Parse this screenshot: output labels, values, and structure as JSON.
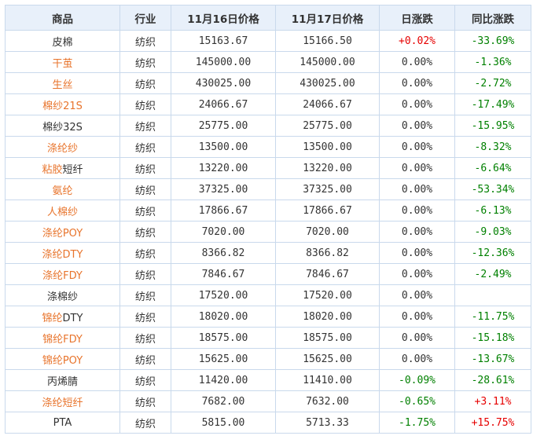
{
  "table": {
    "headers": [
      "商品",
      "行业",
      "11月16日价格",
      "11月17日价格",
      "日涨跌",
      "同比涨跌"
    ],
    "rows": [
      {
        "name": "皮棉",
        "name_link": "",
        "industry": "纺织",
        "price_1": "15163.67",
        "price_2": "15166.50",
        "daily": "+0.02%",
        "daily_dir": "up",
        "yoy": "-33.69%",
        "yoy_dir": "down"
      },
      {
        "name": "",
        "name_link": "干茧",
        "industry": "纺织",
        "price_1": "145000.00",
        "price_2": "145000.00",
        "daily": "0.00%",
        "daily_dir": "flat",
        "yoy": "-1.36%",
        "yoy_dir": "down"
      },
      {
        "name": "",
        "name_link": "生丝",
        "industry": "纺织",
        "price_1": "430025.00",
        "price_2": "430025.00",
        "daily": "0.00%",
        "daily_dir": "flat",
        "yoy": "-2.72%",
        "yoy_dir": "down"
      },
      {
        "name": "",
        "name_link": "棉纱21S",
        "industry": "纺织",
        "price_1": "24066.67",
        "price_2": "24066.67",
        "daily": "0.00%",
        "daily_dir": "flat",
        "yoy": "-17.49%",
        "yoy_dir": "down"
      },
      {
        "name": "棉纱32S",
        "name_link": "",
        "industry": "纺织",
        "price_1": "25775.00",
        "price_2": "25775.00",
        "daily": "0.00%",
        "daily_dir": "flat",
        "yoy": "-15.95%",
        "yoy_dir": "down"
      },
      {
        "name": "",
        "name_link": "涤纶纱",
        "industry": "纺织",
        "price_1": "13500.00",
        "price_2": "13500.00",
        "daily": "0.00%",
        "daily_dir": "flat",
        "yoy": "-8.32%",
        "yoy_dir": "down"
      },
      {
        "name": "短纤",
        "name_link": "粘胶",
        "industry": "纺织",
        "price_1": "13220.00",
        "price_2": "13220.00",
        "daily": "0.00%",
        "daily_dir": "flat",
        "yoy": "-6.64%",
        "yoy_dir": "down"
      },
      {
        "name": "",
        "name_link": "氨纶",
        "industry": "纺织",
        "price_1": "37325.00",
        "price_2": "37325.00",
        "daily": "0.00%",
        "daily_dir": "flat",
        "yoy": "-53.34%",
        "yoy_dir": "down"
      },
      {
        "name": "",
        "name_link": "人棉纱",
        "industry": "纺织",
        "price_1": "17866.67",
        "price_2": "17866.67",
        "daily": "0.00%",
        "daily_dir": "flat",
        "yoy": "-6.13%",
        "yoy_dir": "down"
      },
      {
        "name": "",
        "name_link": "涤纶POY",
        "industry": "纺织",
        "price_1": "7020.00",
        "price_2": "7020.00",
        "daily": "0.00%",
        "daily_dir": "flat",
        "yoy": "-9.03%",
        "yoy_dir": "down"
      },
      {
        "name": "",
        "name_link": "涤纶DTY",
        "industry": "纺织",
        "price_1": "8366.82",
        "price_2": "8366.82",
        "daily": "0.00%",
        "daily_dir": "flat",
        "yoy": "-12.36%",
        "yoy_dir": "down"
      },
      {
        "name": "",
        "name_link": "涤纶FDY",
        "industry": "纺织",
        "price_1": "7846.67",
        "price_2": "7846.67",
        "daily": "0.00%",
        "daily_dir": "flat",
        "yoy": "-2.49%",
        "yoy_dir": "down"
      },
      {
        "name": "涤棉纱",
        "name_link": "",
        "industry": "纺织",
        "price_1": "17520.00",
        "price_2": "17520.00",
        "daily": "0.00%",
        "daily_dir": "flat",
        "yoy": "",
        "yoy_dir": "flat"
      },
      {
        "name": "DTY",
        "name_link": "锦纶",
        "industry": "纺织",
        "price_1": "18020.00",
        "price_2": "18020.00",
        "daily": "0.00%",
        "daily_dir": "flat",
        "yoy": "-11.75%",
        "yoy_dir": "down"
      },
      {
        "name": "",
        "name_link": "锦纶FDY",
        "industry": "纺织",
        "price_1": "18575.00",
        "price_2": "18575.00",
        "daily": "0.00%",
        "daily_dir": "flat",
        "yoy": "-15.18%",
        "yoy_dir": "down"
      },
      {
        "name": "",
        "name_link": "锦纶POY",
        "industry": "纺织",
        "price_1": "15625.00",
        "price_2": "15625.00",
        "daily": "0.00%",
        "daily_dir": "flat",
        "yoy": "-13.67%",
        "yoy_dir": "down"
      },
      {
        "name": "丙烯腈",
        "name_link": "",
        "industry": "纺织",
        "price_1": "11420.00",
        "price_2": "11410.00",
        "daily": "-0.09%",
        "daily_dir": "down",
        "yoy": "-28.61%",
        "yoy_dir": "down"
      },
      {
        "name": "",
        "name_link": "涤纶短纤",
        "industry": "纺织",
        "price_1": "7682.00",
        "price_2": "7632.00",
        "daily": "-0.65%",
        "daily_dir": "down",
        "yoy": "+3.11%",
        "yoy_dir": "up"
      },
      {
        "name": "PTA",
        "name_link": "",
        "industry": "纺织",
        "price_1": "5815.00",
        "price_2": "5713.33",
        "daily": "-1.75%",
        "daily_dir": "down",
        "yoy": "+15.75%",
        "yoy_dir": "up"
      }
    ]
  },
  "colors": {
    "header_bg": "#e8f0fa",
    "border": "#c9d9ec",
    "link": "#e8742c",
    "up": "#e60000",
    "down": "#008000"
  }
}
